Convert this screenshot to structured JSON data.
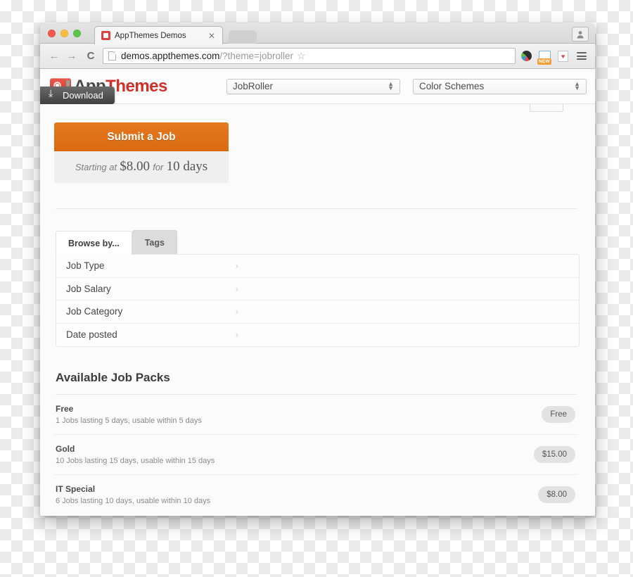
{
  "browser": {
    "tab": {
      "title": "AppThemes Demos",
      "close_label": "✕",
      "favicon": "appthemes-favicon"
    },
    "nav": {
      "back": "←",
      "forward": "→",
      "reload": "C"
    },
    "omnibox": {
      "url_host": "demos.appthemes.com",
      "url_path": "/?theme=jobroller",
      "star": "☆"
    },
    "extensions": [
      {
        "name": "color-circle-icon"
      },
      {
        "name": "new-badge-icon",
        "badge": "NEW"
      },
      {
        "name": "heart-icon",
        "glyph": "♥"
      }
    ],
    "menu_label": "⋮",
    "profile_label": "profile-icon"
  },
  "site": {
    "logo": {
      "app": "App",
      "themes": "Themes"
    },
    "download_label": "Download",
    "selects": [
      {
        "name": "theme-select",
        "value": "JobRoller"
      },
      {
        "name": "color-scheme-select",
        "value": "Color Schemes"
      }
    ]
  },
  "submit": {
    "button_label": "Submit a Job",
    "note_prefix": "Starting at",
    "note_price": "$8.00",
    "note_mid": "for",
    "note_days": "10 days"
  },
  "browse": {
    "tabs": [
      {
        "label": "Browse by...",
        "active": true
      },
      {
        "label": "Tags",
        "active": false
      }
    ],
    "rows": [
      {
        "label": "Job Type",
        "chevron": "›"
      },
      {
        "label": "Job Salary",
        "chevron": "›"
      },
      {
        "label": "Job Category",
        "chevron": "›"
      },
      {
        "label": "Date posted",
        "chevron": "›"
      }
    ]
  },
  "packs": {
    "title": "Available Job Packs",
    "items": [
      {
        "name": "Free",
        "desc": "1 Jobs lasting 5 days, usable within 5 days",
        "price": "Free"
      },
      {
        "name": "Gold",
        "desc": "10 Jobs lasting 15 days, usable within 15 days",
        "price": "$15.00"
      },
      {
        "name": "IT Special",
        "desc": "6 Jobs lasting 10 days, usable within 10 days",
        "price": "$8.00"
      }
    ]
  },
  "colors": {
    "accent_orange": "#e0701a",
    "brand_red": "#d0302a",
    "download_gray": "#4a4a4a"
  }
}
